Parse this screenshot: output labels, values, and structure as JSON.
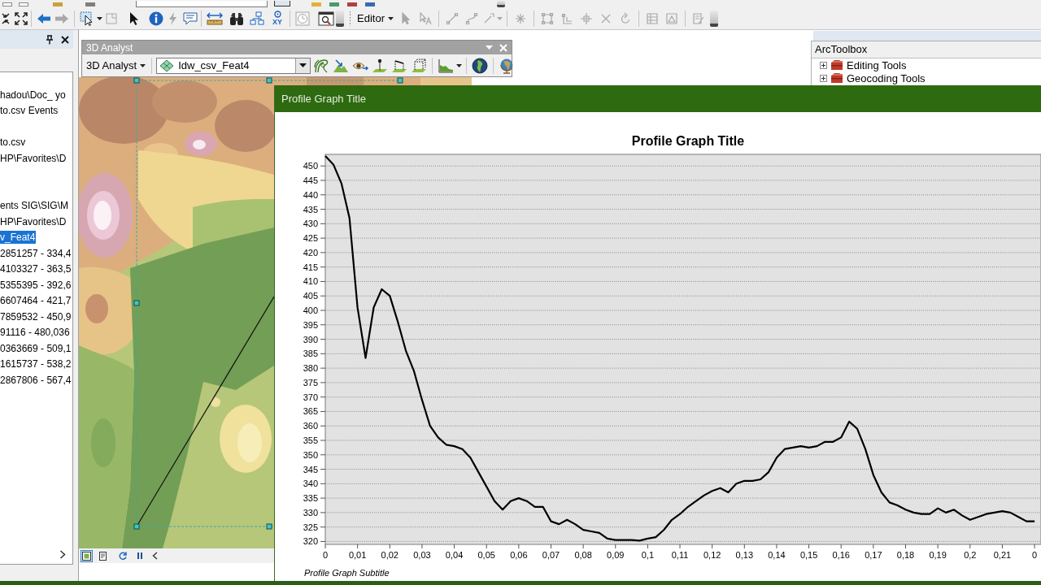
{
  "main_toolbar": {
    "back": {
      "disabled": false
    },
    "forward": {
      "disabled": true
    },
    "clear_selection": {
      "disabled": true
    },
    "hyperlink": {
      "disabled": true
    },
    "goto_xy": {
      "label": "XY"
    },
    "time_slider": {
      "disabled": true
    },
    "editor_menu": {
      "label": "Editor"
    },
    "edit_tools": {
      "disabled": true
    }
  },
  "table_of_contents": {
    "groups": [
      {
        "items": [
          {
            "label": "hadou\\Doc_ yo",
            "selected": false
          },
          {
            "label": "to.csv Events",
            "selected": false
          }
        ]
      },
      {
        "items": [
          {
            "label": "to.csv",
            "selected": false
          },
          {
            "label": "HP\\Favorites\\D",
            "selected": false
          }
        ]
      },
      {
        "items": [
          {
            "label": "ents SIG\\SIG\\M",
            "selected": false
          },
          {
            "label": "HP\\Favorites\\D",
            "selected": false
          },
          {
            "label": "v_Feat4",
            "selected": true
          },
          {
            "label": "2851257 - 334,4",
            "selected": false
          },
          {
            "label": "4103327 - 363,5",
            "selected": false
          },
          {
            "label": "5355395 - 392,6",
            "selected": false
          },
          {
            "label": "6607464 - 421,7",
            "selected": false
          },
          {
            "label": "7859532 - 450,9",
            "selected": false
          },
          {
            "label": "91116 - 480,036",
            "selected": false
          },
          {
            "label": "0363669 - 509,1",
            "selected": false
          },
          {
            "label": "1615737 - 538,2",
            "selected": false
          },
          {
            "label": "2867806 - 567,4",
            "selected": false
          }
        ]
      }
    ]
  },
  "analyst_toolbar": {
    "title": "3D Analyst",
    "menu": "3D Analyst",
    "layer": "Idw_csv_Feat4"
  },
  "map_view": {
    "view_buttons": [
      {
        "kind": "data",
        "selected": true
      },
      {
        "kind": "layout",
        "selected": false
      }
    ]
  },
  "arctoolbox": {
    "title": "ArcToolbox",
    "items": [
      {
        "label": "Editing Tools",
        "expanded": false
      },
      {
        "label": "Geocoding Tools",
        "expanded": false
      }
    ]
  },
  "profile_window": {
    "title": "Profile Graph Title",
    "chart_data": [
      {
        "type": "line",
        "title": "Profile Graph Title",
        "subtitle": "Profile Graph Subtitle",
        "color": "#000000",
        "grid": true,
        "xlim": [
          0,
          0.222
        ],
        "ylim": [
          319,
          454
        ],
        "xticks": [
          {
            "value": 0,
            "label": "0"
          },
          {
            "value": 0.01,
            "label": "0,01"
          },
          {
            "value": 0.02,
            "label": "0,02"
          },
          {
            "value": 0.03,
            "label": "0,03"
          },
          {
            "value": 0.04,
            "label": "0,04"
          },
          {
            "value": 0.05,
            "label": "0,05"
          },
          {
            "value": 0.06,
            "label": "0,06"
          },
          {
            "value": 0.07,
            "label": "0,07"
          },
          {
            "value": 0.08,
            "label": "0,08"
          },
          {
            "value": 0.09,
            "label": "0,09"
          },
          {
            "value": 0.1,
            "label": "0,1"
          },
          {
            "value": 0.11,
            "label": "0,11"
          },
          {
            "value": 0.12,
            "label": "0,12"
          },
          {
            "value": 0.13,
            "label": "0,13"
          },
          {
            "value": 0.14,
            "label": "0,14"
          },
          {
            "value": 0.15,
            "label": "0,15"
          },
          {
            "value": 0.16,
            "label": "0,16"
          },
          {
            "value": 0.17,
            "label": "0,17"
          },
          {
            "value": 0.18,
            "label": "0,18"
          },
          {
            "value": 0.19,
            "label": "0,19"
          },
          {
            "value": 0.2,
            "label": "0,2"
          },
          {
            "value": 0.21,
            "label": "0,21"
          },
          {
            "value": 0.22,
            "label": "0"
          }
        ],
        "yticks": [
          320,
          325,
          330,
          335,
          340,
          345,
          350,
          355,
          360,
          365,
          370,
          375,
          380,
          385,
          390,
          395,
          400,
          405,
          410,
          415,
          420,
          425,
          430,
          435,
          440,
          445,
          450
        ],
        "x": [
          0,
          0.0025,
          0.005,
          0.0075,
          0.01,
          0.0125,
          0.015,
          0.0175,
          0.02,
          0.0225,
          0.025,
          0.0275,
          0.03,
          0.0325,
          0.035,
          0.0375,
          0.04,
          0.0425,
          0.045,
          0.0475,
          0.05,
          0.0525,
          0.055,
          0.0575,
          0.06,
          0.0625,
          0.065,
          0.0675,
          0.07,
          0.0725,
          0.075,
          0.0775,
          0.08,
          0.0825,
          0.085,
          0.0875,
          0.09,
          0.0925,
          0.095,
          0.0975,
          0.1,
          0.1025,
          0.105,
          0.1075,
          0.11,
          0.1125,
          0.115,
          0.1175,
          0.12,
          0.1225,
          0.125,
          0.1275,
          0.13,
          0.1325,
          0.135,
          0.1375,
          0.14,
          0.1425,
          0.145,
          0.1475,
          0.15,
          0.1525,
          0.155,
          0.1575,
          0.16,
          0.1625,
          0.165,
          0.1675,
          0.17,
          0.1725,
          0.175,
          0.1775,
          0.18,
          0.1825,
          0.185,
          0.1875,
          0.19,
          0.1925,
          0.195,
          0.1975,
          0.2,
          0.2025,
          0.205,
          0.2075,
          0.21,
          0.2125,
          0.215,
          0.2175,
          0.22
        ],
        "values": [
          453.4,
          450.5,
          444,
          432,
          401,
          383.5,
          401,
          407.3,
          405,
          396,
          386,
          379,
          369,
          360,
          356,
          353.5,
          353,
          352,
          349,
          344,
          339,
          334,
          331,
          334,
          335,
          334,
          332,
          332,
          327,
          326,
          327.5,
          326,
          324,
          323.5,
          323,
          321,
          320.5,
          320.5,
          320.5,
          320.3,
          321,
          321.5,
          324,
          327.5,
          329.5,
          332,
          334,
          336,
          337.5,
          338.5,
          337,
          340,
          341,
          341,
          341.5,
          344,
          349,
          352,
          352.5,
          353,
          352.5,
          353,
          354.5,
          354.5,
          356,
          361.5,
          359,
          352,
          343,
          337,
          333.5,
          332.5,
          331,
          330,
          329.5,
          329.5,
          331.5,
          330,
          331,
          329,
          327.5,
          328.5,
          329.5,
          330,
          330.5,
          330,
          328.5,
          327,
          327
        ]
      }
    ]
  }
}
